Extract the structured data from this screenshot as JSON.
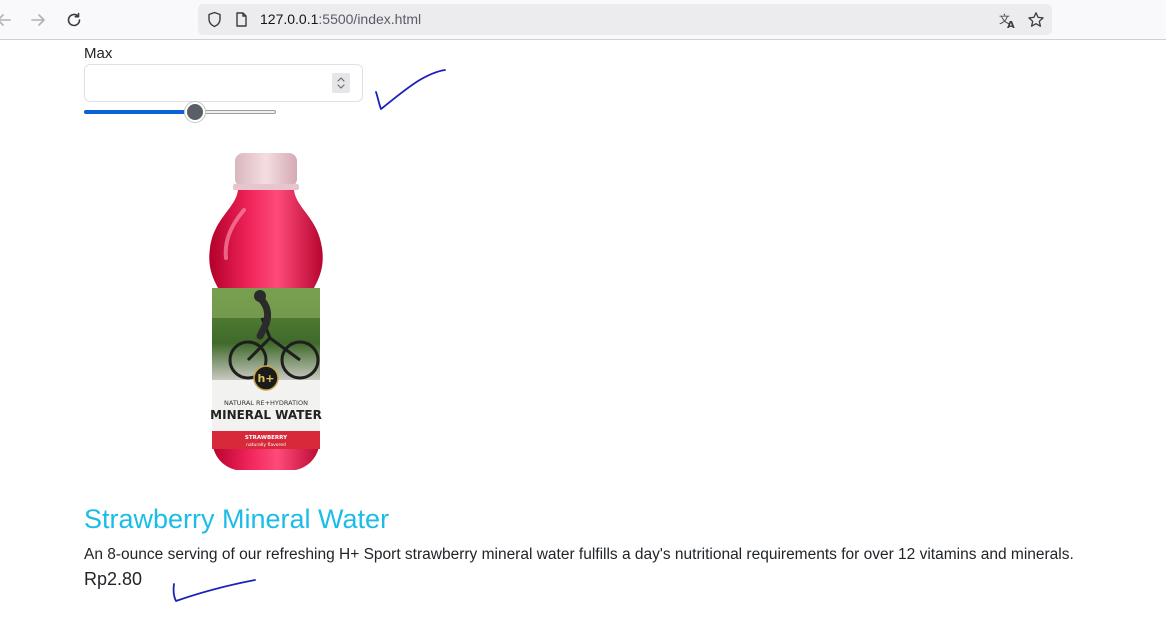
{
  "browser": {
    "url_host": "127.0.0.1",
    "url_rest": ":5500/index.html",
    "back_icon": "arrow-left-icon",
    "forward_icon": "arrow-right-icon",
    "reload_icon": "reload-icon",
    "security_icon": "shield-icon",
    "page_icon": "page-icon",
    "translate_icon": "translate-icon",
    "bookmark_icon": "star-icon"
  },
  "filter": {
    "max_label": "Max",
    "max_value": "",
    "range_level_fraction": 0.58
  },
  "product": {
    "title": "Strawberry Mineral Water",
    "description": "An 8-ounce serving of our refreshing H+ Sport strawberry mineral water fulfills a day's nutritional requirements for over 12 vitamins and minerals.",
    "price": "Rp2.80",
    "label_brand": "h+",
    "label_line1": "NATURAL RE+HYDRATION",
    "label_line2": "MINERAL WATER",
    "label_flavor": "STRAWBERRY",
    "label_flavor_note": "naturally flavored"
  },
  "colors": {
    "title": "#1bbde8",
    "range_fill": "#0b61d6",
    "annotation_ink": "#1a22b8",
    "bottle_red": "#e8174a"
  }
}
